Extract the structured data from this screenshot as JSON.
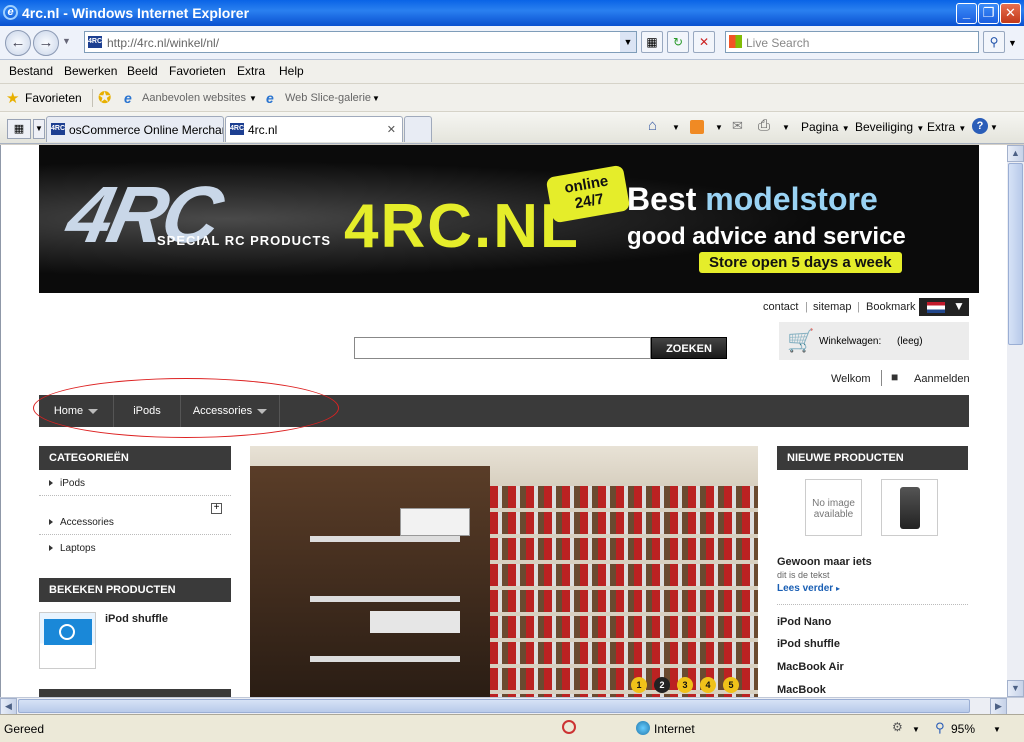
{
  "window": {
    "title": "4rc.nl - Windows Internet Explorer",
    "minimize": "_",
    "maximize": "❐",
    "close": "✕"
  },
  "address": {
    "url": "http://4rc.nl/winkel/nl/",
    "search_placeholder": "Live Search"
  },
  "menu": [
    "Bestand",
    "Bewerken",
    "Beeld",
    "Favorieten",
    "Extra",
    "Help"
  ],
  "favbar": {
    "favorites": "Favorieten",
    "suggested": "Aanbevolen websites",
    "webslice": "Web Slice-galerie"
  },
  "tabs": [
    {
      "label": "osCommerce Online Merchan...",
      "active": false
    },
    {
      "label": "4rc.nl",
      "active": true
    }
  ],
  "commandbar": {
    "page": "Pagina",
    "security": "Beveiliging",
    "tools": "Extra"
  },
  "banner": {
    "logo_text": "4RC",
    "logo_subtitle": "SPECIAL RC PRODUCTS",
    "brand": "4RC.NL",
    "online_line1": "online",
    "online_line2": "24/7",
    "tagline_best": "Best",
    "tagline_store": "modelstore",
    "advice": "good advice and service",
    "open_days": "Store open 5 days a week"
  },
  "header_links": [
    "contact",
    "sitemap",
    "Bookmark"
  ],
  "search": {
    "button": "ZOEKEN",
    "value": ""
  },
  "cart": {
    "label": "Winkelwagen:",
    "status": "(leeg)"
  },
  "account": {
    "welcome": "Welkom",
    "login": "Aanmelden"
  },
  "nav": [
    {
      "label": "Home",
      "dropdown": true
    },
    {
      "label": "iPods",
      "dropdown": false
    },
    {
      "label": "Accessories",
      "dropdown": true
    }
  ],
  "categories": {
    "title": "CATEGORIEËN",
    "items": [
      "iPods",
      "Accessories",
      "Laptops"
    ]
  },
  "viewed": {
    "title": "BEKEKEN PRODUCTEN",
    "product": "iPod shuffle"
  },
  "slider": {
    "pages": [
      "1",
      "2",
      "3",
      "4",
      "5"
    ],
    "active_page": "2"
  },
  "new_products": {
    "title": "NIEUWE PRODUCTEN",
    "no_image": "No image available",
    "featured_name": "Gewoon maar iets",
    "featured_desc": "dit is de tekst",
    "read_more": "Lees verder",
    "items": [
      "iPod Nano",
      "iPod shuffle",
      "MacBook Air",
      "MacBook"
    ]
  },
  "status": {
    "left": "Gereed",
    "zone": "Internet",
    "zoom": "95%"
  },
  "colors": {
    "accent_yellow": "#e5ed2a",
    "nav_dark": "#3a3a3a",
    "highlight_oval": "#dd2222",
    "link_blue": "#1a5fb4"
  }
}
